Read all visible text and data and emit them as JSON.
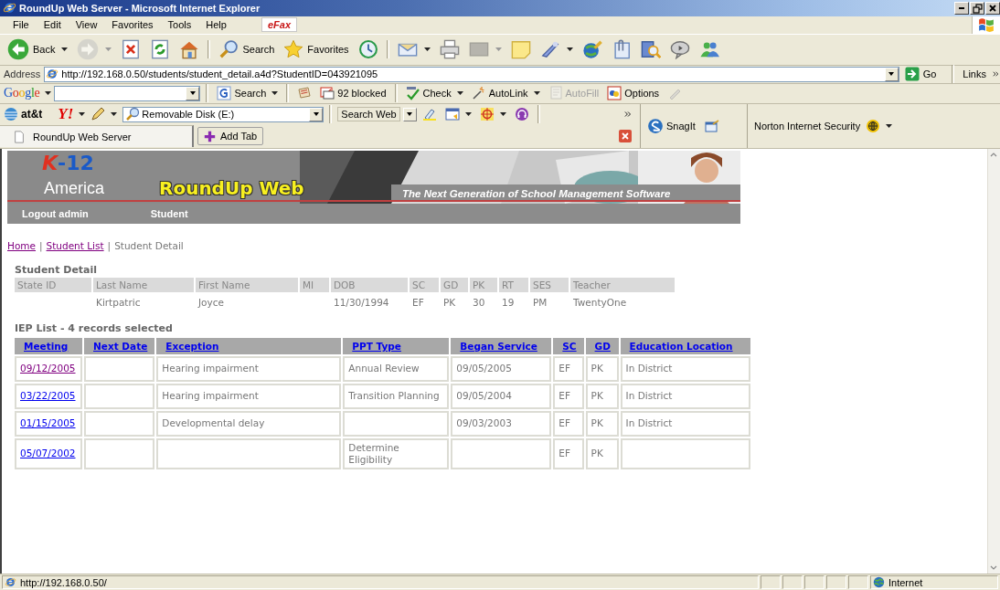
{
  "window": {
    "title": "RoundUp Web Server - Microsoft Internet Explorer"
  },
  "menu": [
    "File",
    "Edit",
    "View",
    "Favorites",
    "Tools",
    "Help"
  ],
  "efax": "eFax",
  "toolbar": [
    {
      "kind": "back",
      "label": "Back",
      "dropdown": true,
      "disabled": false
    },
    {
      "kind": "forward",
      "dropdown": true,
      "disabled": true
    },
    {
      "kind": "stop",
      "dropdown": false,
      "disabled": false
    },
    {
      "kind": "refresh",
      "dropdown": false,
      "disabled": false
    },
    {
      "kind": "home",
      "dropdown": false,
      "disabled": false
    },
    {
      "kind": "separator"
    },
    {
      "kind": "search",
      "label": "Search",
      "dropdown": false,
      "disabled": false
    },
    {
      "kind": "favorites",
      "label": "Favorites",
      "dropdown": false,
      "disabled": false
    },
    {
      "kind": "history",
      "dropdown": false,
      "disabled": false
    },
    {
      "kind": "separator"
    },
    {
      "kind": "mail",
      "dropdown": true,
      "disabled": false
    },
    {
      "kind": "print",
      "dropdown": false,
      "disabled": false
    },
    {
      "kind": "edit",
      "dropdown": true,
      "disabled": true
    },
    {
      "kind": "note",
      "dropdown": false,
      "disabled": false
    },
    {
      "kind": "messenger",
      "dropdown": true,
      "disabled": false
    },
    {
      "kind": "globe",
      "dropdown": false,
      "disabled": false
    },
    {
      "kind": "clip",
      "dropdown": false,
      "disabled": false
    },
    {
      "kind": "research",
      "dropdown": false,
      "disabled": false
    },
    {
      "kind": "discuss",
      "dropdown": false,
      "disabled": false
    },
    {
      "kind": "people",
      "dropdown": false,
      "disabled": false
    }
  ],
  "address": {
    "label": "Address",
    "value": "http://192.168.0.50/students/student_detail.a4d?StudentID=043921095",
    "go": "Go",
    "links": "Links"
  },
  "google_bar": {
    "logo": "Google",
    "items": [
      {
        "kind": "search",
        "label": "Search",
        "dropdown": true,
        "disabled": false
      },
      {
        "kind": "separator"
      },
      {
        "kind": "news",
        "dropdown": false,
        "disabled": false
      },
      {
        "kind": "popups",
        "label": "92 blocked",
        "dropdown": false,
        "disabled": false
      },
      {
        "kind": "separator"
      },
      {
        "kind": "check",
        "label": "Check",
        "dropdown": true,
        "disabled": false
      },
      {
        "kind": "autolink",
        "label": "AutoLink",
        "dropdown": true,
        "disabled": false
      },
      {
        "kind": "autofill",
        "label": "AutoFill",
        "dropdown": false,
        "disabled": true
      },
      {
        "kind": "options",
        "label": "Options",
        "dropdown": false,
        "disabled": false
      },
      {
        "kind": "highlight",
        "dropdown": false,
        "disabled": true
      }
    ]
  },
  "att_bar": {
    "logo": "at&t",
    "yahoo": "Y!",
    "search_value": "Removable Disk (E:)",
    "search_button": "Search Web"
  },
  "snagit": "SnagIt",
  "norton": "Norton Internet Security",
  "tabs": [
    {
      "label": "RoundUp Web Server",
      "selected": true
    }
  ],
  "add_tab": "Add Tab",
  "banner": {
    "logo_top": "K-12",
    "logo_bottom": "America",
    "title": "RoundUp Web",
    "tagline": "The Next Generation of School Management Software"
  },
  "nav": [
    "Logout admin",
    "Student"
  ],
  "breadcrumb": {
    "separator": "|",
    "items": [
      {
        "kind": "link",
        "label": "Home"
      },
      {
        "kind": "link",
        "label": "Student List"
      },
      {
        "kind": "current",
        "label": "Student Detail"
      }
    ]
  },
  "student_detail": {
    "title": "Student Detail",
    "columns": [
      "State ID",
      "Last Name",
      "First Name",
      "MI",
      "DOB",
      "SC",
      "GD",
      "PK",
      "RT",
      "SES",
      "Teacher"
    ],
    "cells": [
      {},
      {
        "text": "Kirtpatric"
      },
      {
        "text": "Joyce"
      },
      {},
      {
        "text": "11/30/1994"
      },
      {
        "text": "EF"
      },
      {
        "text": "PK"
      },
      {
        "text": "30"
      },
      {
        "text": "19"
      },
      {
        "text": "PM"
      },
      {
        "text": "TwentyOne"
      }
    ]
  },
  "iep": {
    "title": "IEP List - 4 records selected",
    "columns": [
      "Meeting",
      "Next Date",
      "Exception",
      "PPT Type",
      "Began Service",
      "SC",
      "GD",
      "Education Location"
    ],
    "rows": [
      {
        "visited": true,
        "cells": [
          "09/12/2005",
          null,
          "Hearing impairment",
          "Annual Review",
          "09/05/2005",
          "EF",
          "PK",
          "In District"
        ]
      },
      {
        "visited": false,
        "cells": [
          "03/22/2005",
          null,
          "Hearing impairment",
          "Transition Planning",
          "09/05/2004",
          "EF",
          "PK",
          "In District"
        ]
      },
      {
        "visited": false,
        "cells": [
          "01/15/2005",
          null,
          "Developmental delay",
          null,
          "09/03/2003",
          "EF",
          "PK",
          "In District"
        ]
      },
      {
        "visited": false,
        "cells": [
          "05/07/2002",
          null,
          null,
          "Determine Eligibility",
          null,
          "EF",
          "PK",
          null
        ]
      }
    ]
  },
  "status_bar": {
    "url": "http://192.168.0.50/",
    "zone": "Internet"
  }
}
